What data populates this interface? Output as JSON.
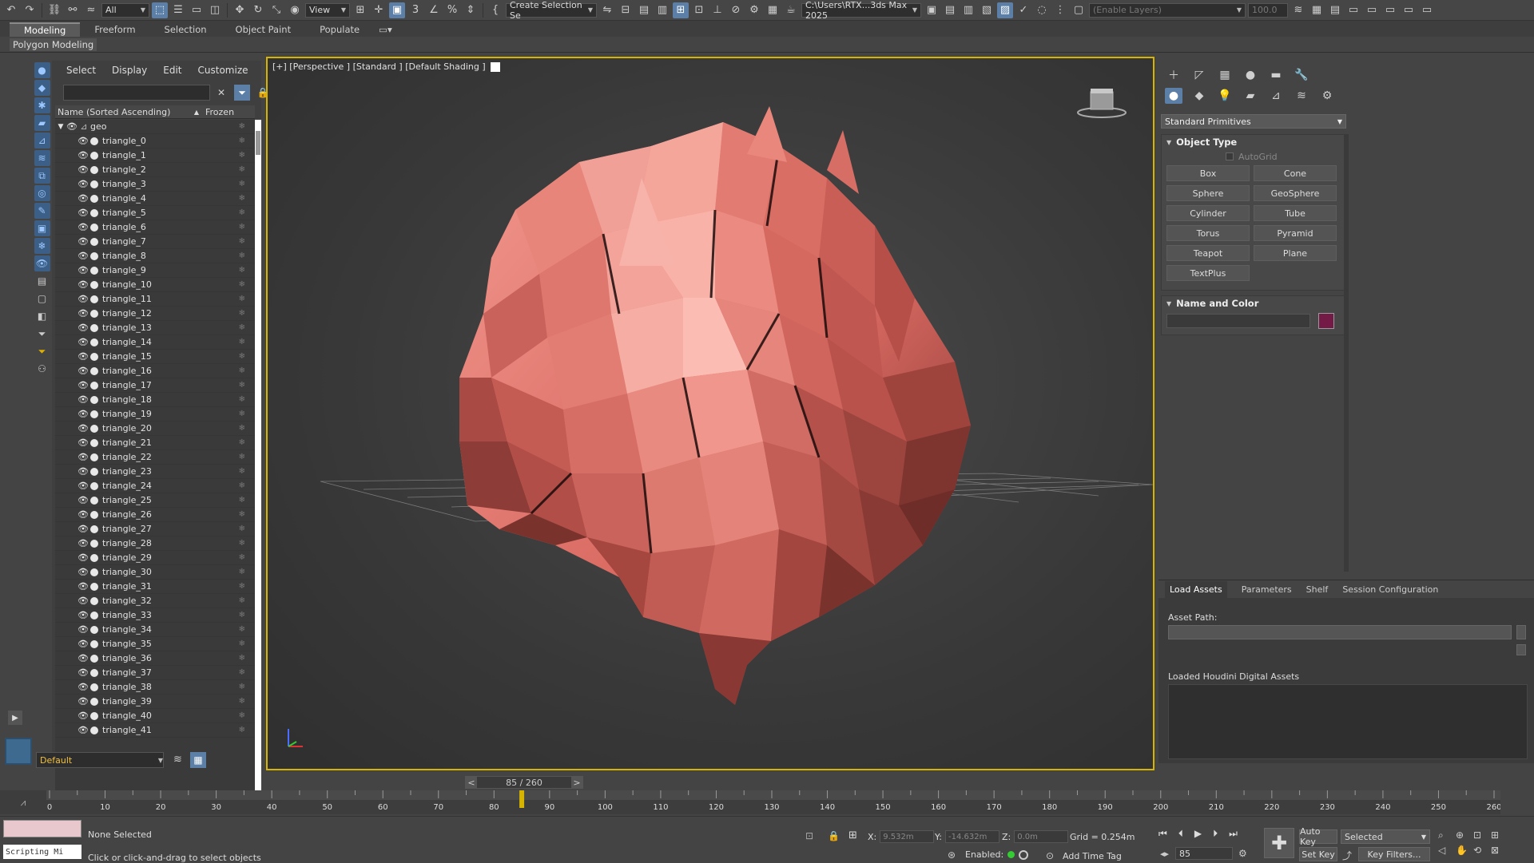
{
  "toolbar": {
    "selection_filter": "All",
    "ref_coord": "View",
    "named_selection": "Create Selection Se",
    "project_path": "C:\\Users\\RTX...3ds Max 2025",
    "layers_placeholder": "(Enable Layers)",
    "value_field": "100.0"
  },
  "ribbon": {
    "tabs": [
      "Modeling",
      "Freeform",
      "Selection",
      "Object Paint",
      "Populate"
    ],
    "sub_label": "Polygon Modeling"
  },
  "explorer": {
    "menu": [
      "Select",
      "Display",
      "Edit",
      "Customize"
    ],
    "col_name": "Name (Sorted Ascending)",
    "col_frozen": "Frozen",
    "sort_indicator": "▲",
    "root": "geo",
    "items": [
      "triangle_0",
      "triangle_1",
      "triangle_2",
      "triangle_3",
      "triangle_4",
      "triangle_5",
      "triangle_6",
      "triangle_7",
      "triangle_8",
      "triangle_9",
      "triangle_10",
      "triangle_11",
      "triangle_12",
      "triangle_13",
      "triangle_14",
      "triangle_15",
      "triangle_16",
      "triangle_17",
      "triangle_18",
      "triangle_19",
      "triangle_20",
      "triangle_21",
      "triangle_22",
      "triangle_23",
      "triangle_24",
      "triangle_25",
      "triangle_26",
      "triangle_27",
      "triangle_28",
      "triangle_29",
      "triangle_30",
      "triangle_31",
      "triangle_32",
      "triangle_33",
      "triangle_34",
      "triangle_35",
      "triangle_36",
      "triangle_37",
      "triangle_38",
      "triangle_39",
      "triangle_40",
      "triangle_41"
    ],
    "layer": "Default"
  },
  "viewport": {
    "label": "[+] [Perspective ] [Standard ] [Default Shading ]",
    "frame_counter": "85 / 260",
    "prev": "<",
    "next": ">"
  },
  "timeline": {
    "ticks": [
      0,
      10,
      20,
      30,
      40,
      50,
      60,
      70,
      80,
      90,
      100,
      110,
      120,
      130,
      140,
      150,
      160,
      170,
      180,
      190,
      200,
      210,
      220,
      230,
      240,
      250,
      260
    ],
    "current_frame": 85,
    "max_frame": 260
  },
  "command_panel": {
    "dropdown": "Standard Primitives",
    "object_type_title": "Object Type",
    "autogrid": "AutoGrid",
    "buttons": [
      "Box",
      "Cone",
      "Sphere",
      "GeoSphere",
      "Cylinder",
      "Tube",
      "Torus",
      "Pyramid",
      "Teapot",
      "Plane",
      "TextPlus"
    ],
    "name_color_title": "Name and Color",
    "object_color": "#731a46"
  },
  "houdini": {
    "tabs": [
      "Load Assets",
      "Parameters",
      "Shelf",
      "Session Configuration"
    ],
    "asset_path_label": "Asset Path:",
    "loaded_label": "Loaded Houdini Digital Assets"
  },
  "status": {
    "script_label": "Scripting Mi",
    "selection": "None Selected",
    "hint": "Click or click-and-drag to select objects",
    "x_label": "X:",
    "x_value": "9.532m",
    "y_label": "Y:",
    "y_value": "-14.632m",
    "z_label": "Z:",
    "z_value": "0.0m",
    "grid": "Grid = 0.254m",
    "enabled": "Enabled:",
    "add_time_tag": "Add Time Tag",
    "frame": "85",
    "auto_key": "Auto Key",
    "set_key": "Set Key",
    "selected": "Selected",
    "key_filters": "Key Filters..."
  },
  "colors": {
    "accent": "#5b7fa6",
    "viewport_border": "#d6b400",
    "mesh": "#e07a70"
  }
}
